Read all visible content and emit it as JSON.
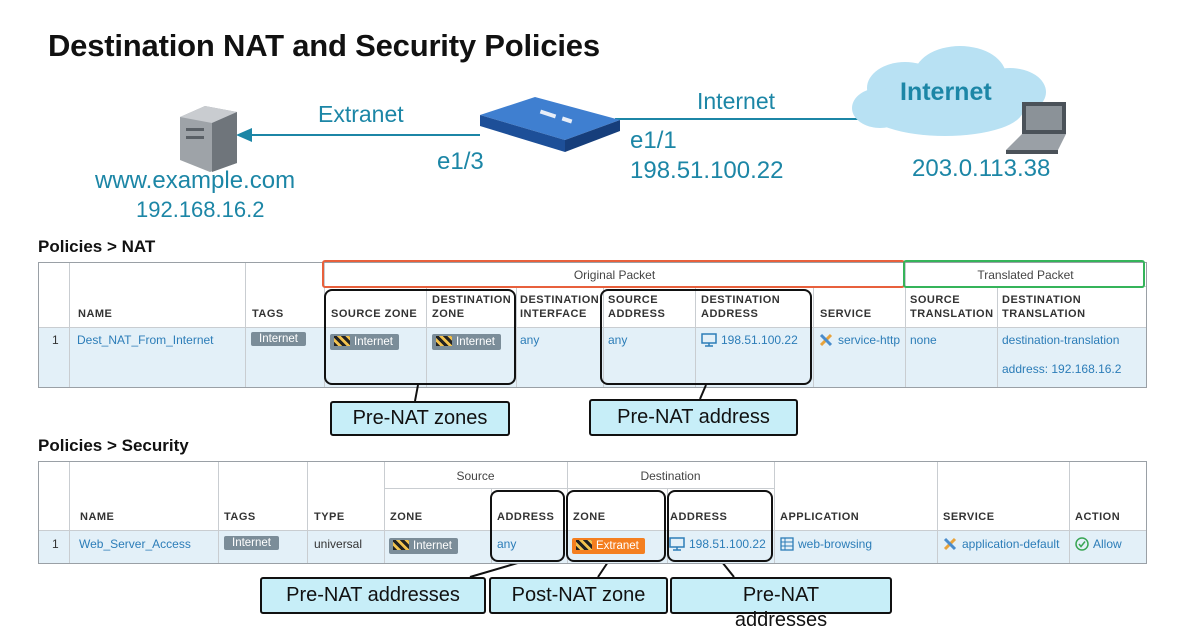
{
  "title": "Destination NAT and Security Policies",
  "diagram": {
    "extranet_label": "Extranet",
    "internet_label": "Internet",
    "cloud_label": "Internet",
    "e13": "e1/3",
    "e11": "e1/1",
    "fw_ip": "198.51.100.22",
    "server_name": "www.example.com",
    "server_ip": "192.168.16.2",
    "client_ip": "203.0.113.38"
  },
  "nat": {
    "section": "Policies > NAT",
    "group_original": "Original Packet",
    "group_translated": "Translated Packet",
    "headers": {
      "name": "NAME",
      "tags": "TAGS",
      "src_zone": "SOURCE ZONE",
      "dst_zone_1": "DESTINATION",
      "dst_zone_2": "ZONE",
      "dst_if_1": "DESTINATION",
      "dst_if_2": "INTERFACE",
      "src_addr_1": "SOURCE",
      "src_addr_2": "ADDRESS",
      "dst_addr_1": "DESTINATION",
      "dst_addr_2": "ADDRESS",
      "service": "SERVICE",
      "src_tr_1": "SOURCE",
      "src_tr_2": "TRANSLATION",
      "dst_tr_1": "DESTINATION",
      "dst_tr_2": "TRANSLATION"
    },
    "row": {
      "num": "1",
      "name": "Dest_NAT_From_Internet",
      "tag": "Internet",
      "src_zone": "Internet",
      "dst_zone": "Internet",
      "dst_if": "any",
      "src_addr": "any",
      "dst_addr": "198.51.100.22",
      "service": "service-http",
      "src_tr": "none",
      "dst_tr_1": "destination-translation",
      "dst_tr_2": "address: 192.168.16.2"
    },
    "callout_zones": "Pre-NAT zones",
    "callout_address": "Pre-NAT address"
  },
  "security": {
    "section": "Policies > Security",
    "group_source": "Source",
    "group_destination": "Destination",
    "headers": {
      "name": "NAME",
      "tags": "TAGS",
      "type": "TYPE",
      "zone": "ZONE",
      "address": "ADDRESS",
      "dzone": "ZONE",
      "daddress": "ADDRESS",
      "application": "APPLICATION",
      "service": "SERVICE",
      "action": "ACTION"
    },
    "row": {
      "num": "1",
      "name": "Web_Server_Access",
      "tag": "Internet",
      "type": "universal",
      "src_zone": "Internet",
      "src_addr": "any",
      "dst_zone": "Extranet",
      "dst_addr": "198.51.100.22",
      "application": "web-browsing",
      "service": "application-default",
      "action": "Allow"
    },
    "callout_pre_addrs": "Pre-NAT addresses",
    "callout_post_zone": "Post-NAT zone",
    "callout_pre_addrs2_1": "Pre-NAT",
    "callout_pre_addrs2_2": "addresses"
  },
  "colors": {
    "teal": "#1c86a6",
    "link": "#2c7db8",
    "row": "#e3f0f8",
    "callout": "#c7eef8",
    "orange_zone": "#f47f20",
    "red_box": "#e8603c",
    "green_box": "#35b45a"
  }
}
